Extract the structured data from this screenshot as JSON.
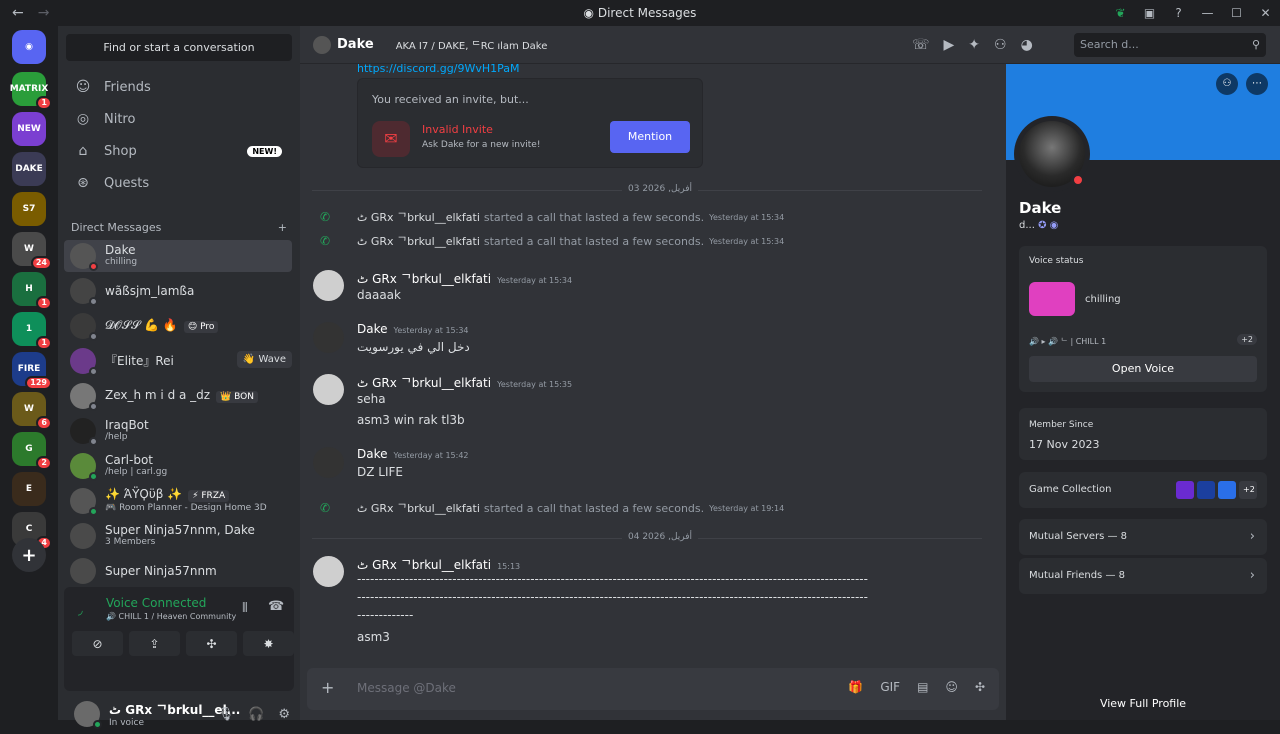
{
  "window": {
    "title": "Direct Messages"
  },
  "guilds": [
    {
      "label": "MATRIX",
      "badge": "1",
      "color": "#2a9d3a"
    },
    {
      "label": "NEW",
      "badge": "",
      "color": "#7b3fd1"
    },
    {
      "label": "DAKE",
      "badge": "",
      "color": "#3b3b55"
    },
    {
      "label": "S7",
      "badge": "",
      "color": "#7a5c00"
    },
    {
      "label": "W",
      "badge": "24",
      "color": "#4a4a4a"
    },
    {
      "label": "H",
      "badge": "1",
      "color": "#1a6f3f"
    },
    {
      "label": "1",
      "badge": "1",
      "color": "#0e8f5a"
    },
    {
      "label": "FIRE",
      "badge": "129",
      "color": "#1d3c8a"
    },
    {
      "label": "W",
      "badge": "6",
      "color": "#6b5a1a"
    },
    {
      "label": "G",
      "badge": "2",
      "color": "#2c7a2c"
    },
    {
      "label": "E",
      "badge": "",
      "color": "#3a2b1c"
    },
    {
      "label": "C",
      "badge": "4",
      "color": "#3a3a3a"
    }
  ],
  "sidebar": {
    "search_placeholder": "Find or start a conversation",
    "nav": [
      {
        "label": "Friends",
        "icon": "friends-icon"
      },
      {
        "label": "Nitro",
        "icon": "nitro-icon"
      },
      {
        "label": "Shop",
        "icon": "shop-icon",
        "badge": "NEW!"
      },
      {
        "label": "Quests",
        "icon": "quests-icon"
      }
    ],
    "dm_header": "Direct Messages",
    "dms": [
      {
        "name": "Dake",
        "sub": "chilling",
        "tag": "",
        "status": "#f23f43",
        "color": "#555"
      },
      {
        "name": "wãßsjm_lamßa",
        "sub": "",
        "tag": "",
        "status": "#80848e",
        "color": "#444"
      },
      {
        "name": "𝓓𝓞𝓢𝓢 💪 🔥",
        "sub": "",
        "tag": "😊 Pro",
        "status": "#80848e",
        "color": "#3a3a3a"
      },
      {
        "name": "『Elite』Rei",
        "sub": "",
        "tag": "",
        "status": "#80848e",
        "color": "#6b3a8a"
      },
      {
        "name": "Zex_h m i d a _dz",
        "sub": "",
        "tag": "👑 BON",
        "status": "#80848e",
        "color": "#777"
      },
      {
        "name": "IraqBot",
        "sub": "/help",
        "tag": "",
        "status": "#80848e",
        "color": "#222"
      },
      {
        "name": "Carl-bot",
        "sub": "/help | carl.gg",
        "tag": "",
        "status": "#23a55a",
        "color": "#5a8a3a"
      },
      {
        "name": "✨ ΆΫϘϋβ ✨",
        "sub": "🎮 Room Planner - Design Home 3D",
        "tag": "⚡ FRZA",
        "status": "#23a55a",
        "color": "#555"
      },
      {
        "name": "Super Ninja57nnm, Dake",
        "sub": "3 Members",
        "tag": "",
        "status": "",
        "color": "#4a4a4a"
      },
      {
        "name": "Super Ninja57nnm",
        "sub": "",
        "tag": "",
        "status": "",
        "color": "#4a4a4a"
      }
    ],
    "wave_label": "👋 Wave",
    "voice": {
      "status": "Voice Connected",
      "server": "🔊 CHILL 1 / Heaven Community"
    },
    "user": {
      "name": "ٹ GRx ᄀbrkul__el...",
      "status": "In voice"
    }
  },
  "chat": {
    "name": "Dake",
    "aka": "AKA   I7 / DAKE, ᄃRC ılam Dake",
    "search_placeholder": "Search d...",
    "link": "https://discord.gg/9WvH1PaM",
    "invite": {
      "title": "You received an invite, but...",
      "name": "Invalid Invite",
      "sub": "Ask Dake for a new invite!",
      "button": "Mention"
    },
    "divider1": "03 2026 ,أفريل",
    "divider2": "04 2026 ,أفريل",
    "calls": [
      {
        "user": "ٹ GRx ᄀbrkul__elkfati",
        "text": "started a call that lasted a few seconds.",
        "time": "Yesterday at 15:34"
      },
      {
        "user": "ٹ GRx ᄀbrkul__elkfati",
        "text": "started a call that lasted a few seconds.",
        "time": "Yesterday at 15:34"
      },
      {
        "user": "ٹ GRx ᄀbrkul__elkfati",
        "text": "started a call that lasted a few seconds.",
        "time": "Yesterday at 19:14"
      }
    ],
    "messages": [
      {
        "user": "ٹ GRx ᄀbrkul__elkfati",
        "time": "Yesterday at 15:34",
        "lines": [
          "daaaak"
        ]
      },
      {
        "user": "Dake",
        "time": "Yesterday at 15:34",
        "lines": [
          "دخل الي في يورسويت"
        ]
      },
      {
        "user": "ٹ GRx ᄀbrkul__elkfati",
        "time": "Yesterday at 15:35",
        "lines": [
          "seha",
          "asm3 win rak tl3b"
        ]
      },
      {
        "user": "Dake",
        "time": "Yesterday at 15:42",
        "lines": [
          "DZ LIFE"
        ]
      },
      {
        "user": "ٹ GRx ᄀbrkul__elkfati",
        "time": "15:13",
        "lines": [
          "----------------------------------------------------------------------------------------------------------------------",
          "----------------------------------------------------------------------------------------------------------------------",
          "-------------",
          "asm3"
        ]
      }
    ],
    "composer_placeholder": "Message @Dake"
  },
  "profile": {
    "name": "Dake",
    "username": "d...",
    "voice_status_label": "Voice status",
    "voice_status": "chilling",
    "voice_server": "🔊 ▸ 🔊 ᄂ | CHILL 1",
    "voice_more": "+2",
    "open_voice": "Open Voice",
    "member_since_label": "Member Since",
    "member_since": "17 Nov 2023",
    "game_collection": "Game Collection",
    "game_more": "+2",
    "mutual_servers": "Mutual Servers — 8",
    "mutual_friends": "Mutual Friends — 8",
    "view_full": "View Full Profile"
  },
  "colors": {
    "accent": "#5865f2",
    "banner": "#1f7ee0",
    "online": "#23a55a",
    "dnd": "#f23f43"
  }
}
